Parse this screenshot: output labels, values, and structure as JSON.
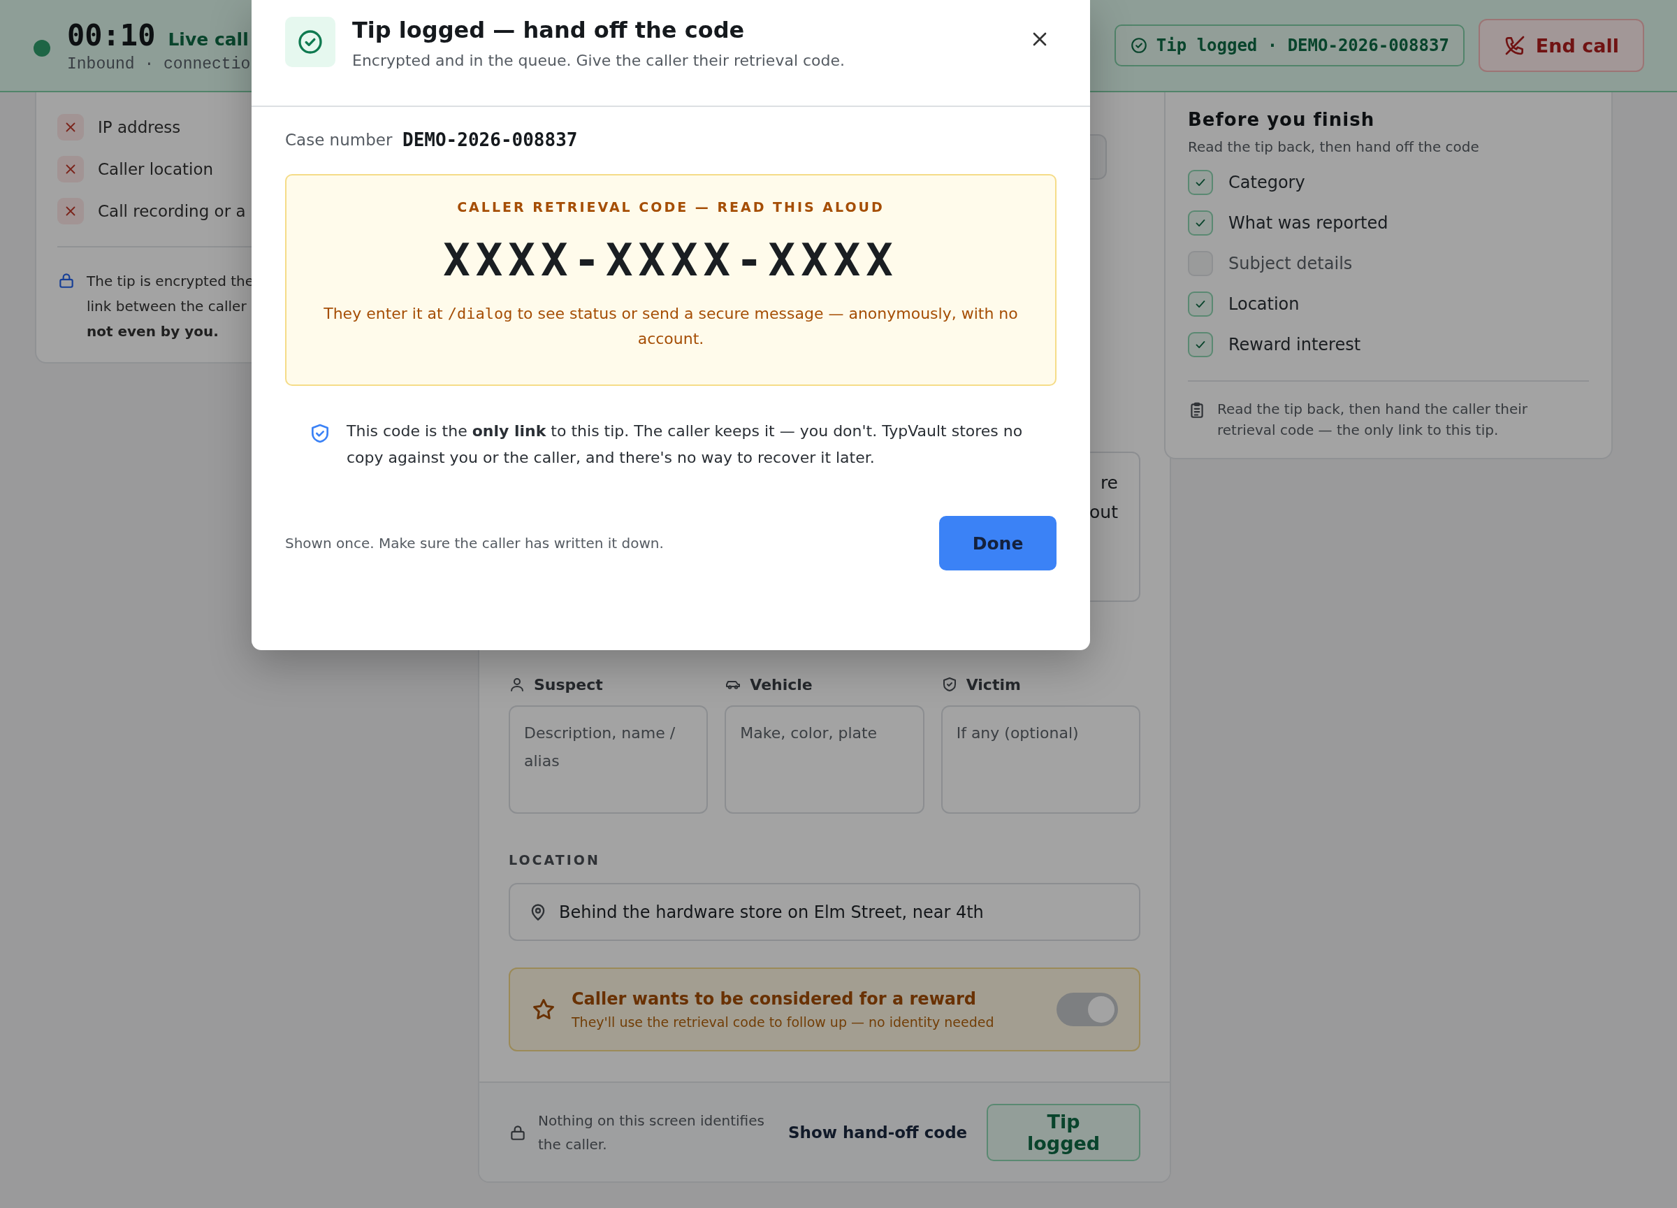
{
  "header": {
    "timer": "00:10",
    "status": "Live call",
    "meta": "Inbound · connectio",
    "tip_badge": "Tip logged · DEMO-2026-008837",
    "end_call": "End call"
  },
  "privacy_panel": {
    "items": [
      {
        "label": "IP address"
      },
      {
        "label": "Caller location"
      },
      {
        "label": "Call recording or a"
      }
    ],
    "note": "The tip is encrypted the\nlink between the caller\n**not even by you.**"
  },
  "form": {
    "report_lines": "re\nout",
    "subjects": [
      {
        "kind": "person",
        "label": "Suspect",
        "placeholder": "Description, name / alias"
      },
      {
        "kind": "vehicle",
        "label": "Vehicle",
        "placeholder": "Make, color, plate"
      },
      {
        "kind": "shield",
        "label": "Victim",
        "placeholder": "If any (optional)"
      }
    ],
    "location_label": "LOCATION",
    "location_value": "Behind the hardware store on Elm Street, near 4th",
    "reward": {
      "title": "Caller wants to be considered for a reward",
      "subtitle": "They'll use the retrieval code to follow up — no identity needed",
      "on": true
    },
    "footer_note": "Nothing on this screen identifies the caller.",
    "show_code_link": "Show hand-off code",
    "submit_button": "Tip logged"
  },
  "checklist": {
    "title": "Before you finish",
    "subtitle": "Read the tip back, then hand off the code",
    "items": [
      {
        "label": "Category",
        "checked": true
      },
      {
        "label": "What was reported",
        "checked": true
      },
      {
        "label": "Subject details",
        "checked": false
      },
      {
        "label": "Location",
        "checked": true
      },
      {
        "label": "Reward interest",
        "checked": true
      }
    ],
    "note": "Read the tip back, then hand the caller their retrieval code — the only link to this tip."
  },
  "modal": {
    "title": "Tip logged — hand off the code",
    "subtitle": "Encrypted and in the queue. Give the caller their retrieval code.",
    "case_label": "Case number",
    "case_number": "DEMO-2026-008837",
    "code_label": "CALLER RETRIEVAL CODE — READ THIS ALOUD",
    "code": "XXXX-XXXX-XXXX",
    "code_help": {
      "before": "They enter it at ",
      "path": "/dialog",
      "after": " to see status or send a secure message — anonymously, with no account."
    },
    "note": "This code is the **only link** to this tip. The caller keeps it — you don't. TypVault stores no copy against you or the caller, and there's no way to recover it later.",
    "footer": "Shown once. Make sure the caller has written it down.",
    "done": "Done"
  }
}
